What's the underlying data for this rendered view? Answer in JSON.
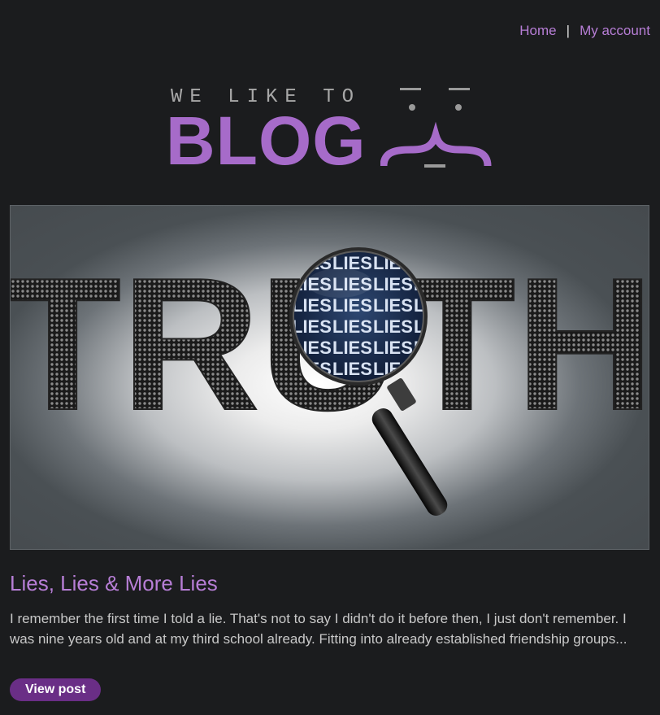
{
  "nav": {
    "home_label": "Home",
    "separator": "|",
    "account_label": "My account"
  },
  "logo": {
    "tagline": "WE LIKE TO",
    "wordmark": "BLOG"
  },
  "hero": {
    "word": "TRUTH",
    "lens_text": "LIES"
  },
  "post": {
    "title": "Lies, Lies & More Lies",
    "summary": "I remember the first time I told a lie. That's not to say I didn't do it before then, I just don't remember. I was nine years old and at my third school already. Fitting into already established friendship groups...",
    "button_label": "View post"
  },
  "colors": {
    "background": "#1b1c1e",
    "accent": "#b77ed6",
    "button": "#6a2e86"
  }
}
